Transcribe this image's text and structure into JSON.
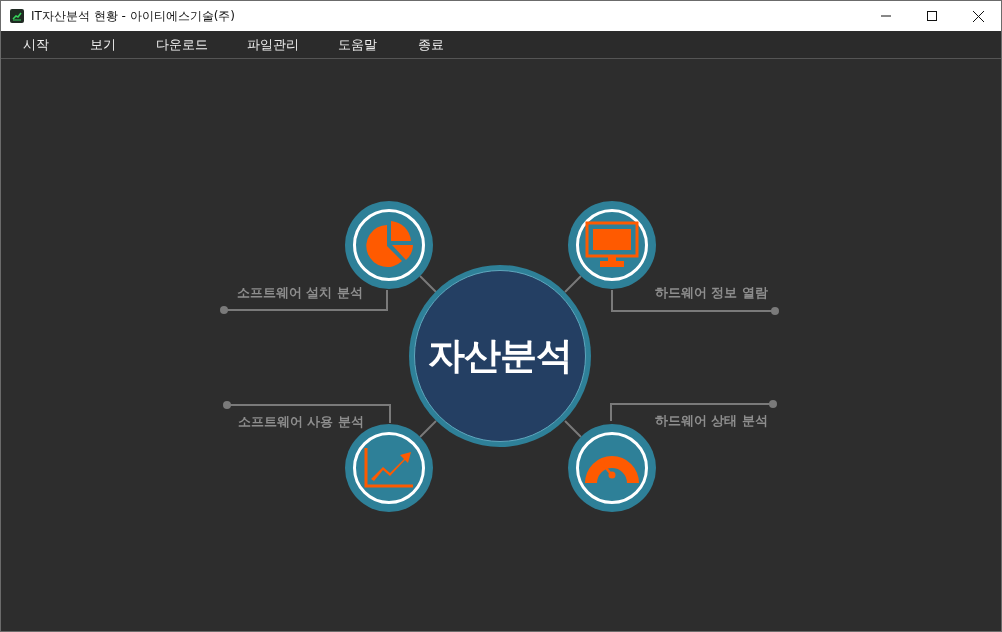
{
  "window": {
    "title": "IT자산분석 현황 - 아이티에스기술(주)"
  },
  "menu": [
    "시작",
    "보기",
    "다운로드",
    "파일관리",
    "도움말",
    "종료"
  ],
  "hub": {
    "label": "자산분석"
  },
  "branches": [
    {
      "kind": "pie",
      "label": "소프트웨어 설치 분석"
    },
    {
      "kind": "monitor",
      "label": "하드웨어 정보 열람"
    },
    {
      "kind": "trend",
      "label": "소프트웨어 사용 분석"
    },
    {
      "kind": "gauge",
      "label": "하드웨어 상태 분석"
    }
  ]
}
